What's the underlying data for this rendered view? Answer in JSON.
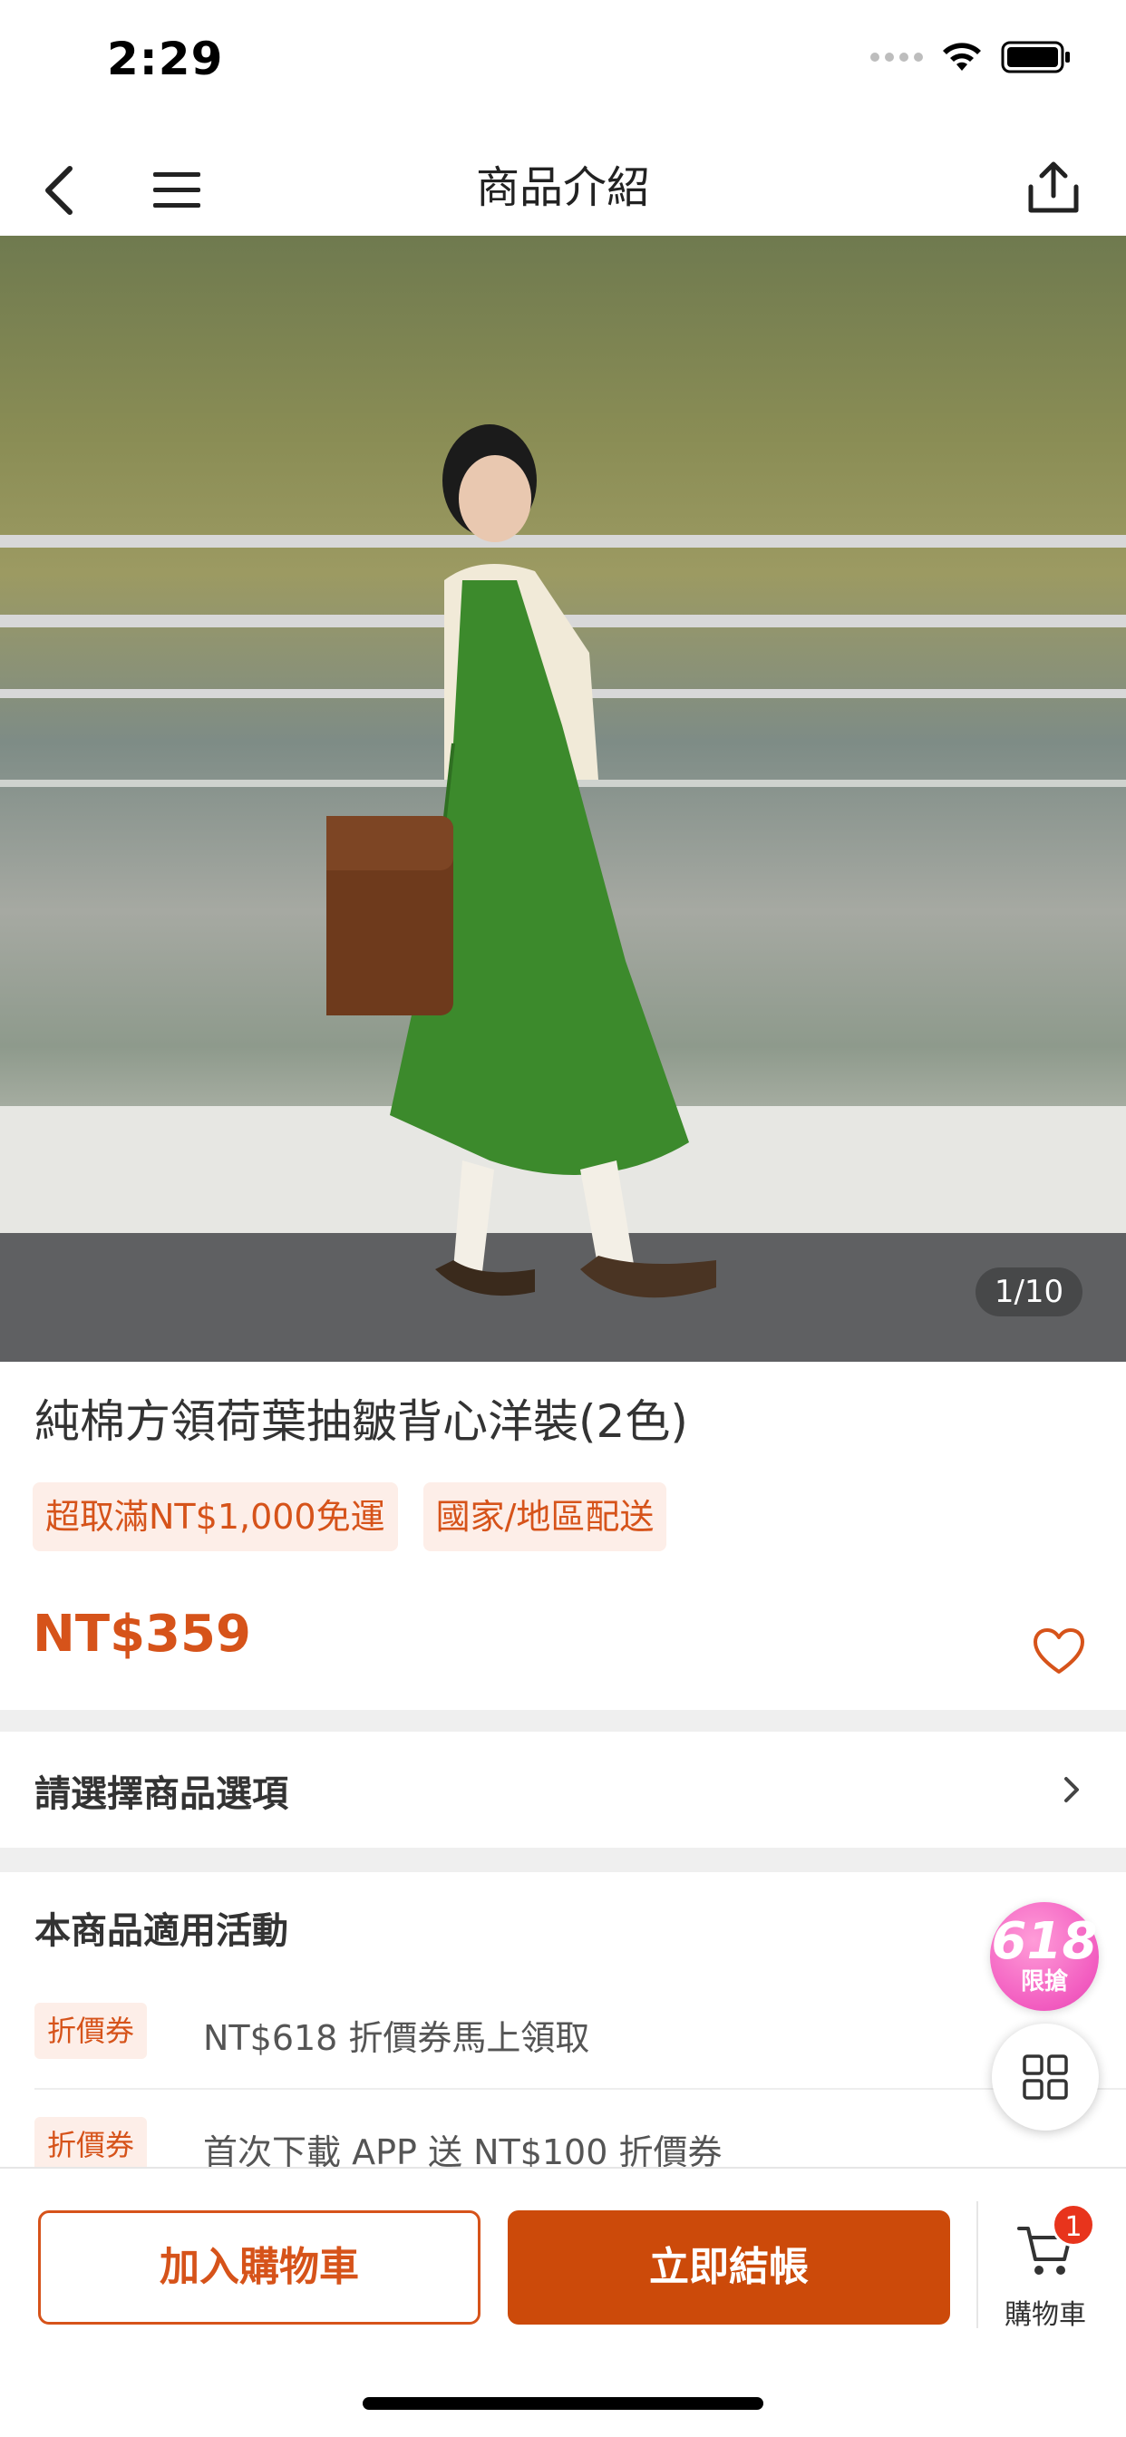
{
  "status_bar": {
    "time": "2:29"
  },
  "nav": {
    "title": "商品介紹",
    "icons": [
      "back-icon",
      "menu-icon",
      "share-icon"
    ]
  },
  "gallery": {
    "counter": "1/10"
  },
  "product": {
    "title": "純棉方領荷葉抽皺背心洋裝(2色)",
    "tags": [
      "超取滿NT$1,000免運",
      "國家/地區配送"
    ],
    "price": "NT$359"
  },
  "options": {
    "label": "請選擇商品選項"
  },
  "promotions": {
    "heading": "本商品適用活動",
    "items": [
      {
        "tag": "折價券",
        "text": "NT$618 折價券馬上領取"
      },
      {
        "tag": "折價券",
        "text": "首次下載 APP 送 NT$100 折價券"
      }
    ]
  },
  "floating": {
    "badge_big": "618",
    "badge_small": "限搶"
  },
  "bottom_bar": {
    "add_to_cart": "加入購物車",
    "checkout": "立即結帳",
    "cart_label": "購物車",
    "cart_count": "1"
  },
  "colors": {
    "accent": "#d6531a",
    "checkout_bg": "#cc4a0a",
    "tag_bg": "#fdeee8",
    "cart_badge": "#e8341c",
    "promo_badge": "#f25cc0"
  }
}
